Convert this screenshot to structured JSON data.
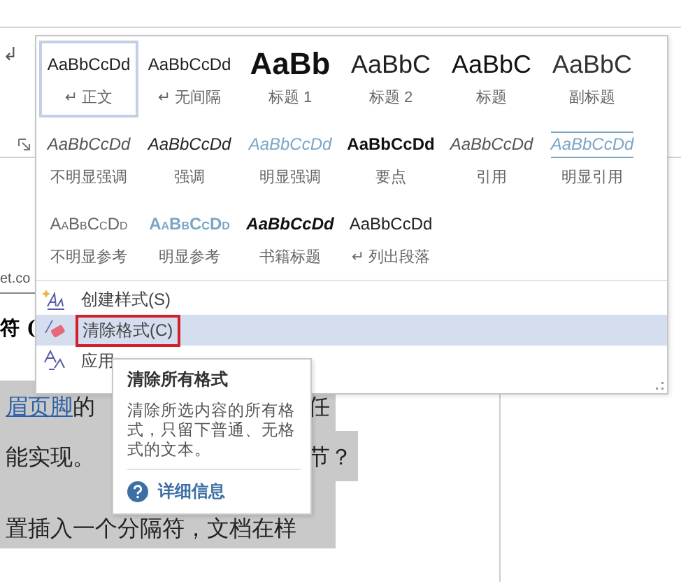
{
  "ribbon": {
    "paragraph_mark": "↲"
  },
  "document": {
    "url_fragment": "et.co",
    "heading_fragment": "符 (",
    "lines": [
      {
        "parts": [
          {
            "text": "眉页脚",
            "kind": "link"
          },
          {
            "text": "的",
            "kind": "text"
          },
          {
            "text": "任",
            "kind": "right"
          }
        ]
      },
      {
        "parts": [
          {
            "text": "能实现。",
            "kind": "text"
          },
          {
            "text": "节？",
            "kind": "right"
          }
        ]
      },
      {
        "parts": [
          {
            "text": "置插入一个分隔符，文档在样",
            "kind": "text"
          }
        ]
      }
    ]
  },
  "style_gallery": {
    "styles": [
      {
        "preview": "AaBbCcDd",
        "name": "↵ 正文",
        "kind": "normal",
        "selected": true
      },
      {
        "preview": "AaBbCcDd",
        "name": "↵ 无间隔",
        "kind": "normal",
        "selected": false
      },
      {
        "preview": "AaBb",
        "name": "标题 1",
        "kind": "heading1",
        "selected": false
      },
      {
        "preview": "AaBbC",
        "name": "标题 2",
        "kind": "heading2",
        "selected": false
      },
      {
        "preview": "AaBbC",
        "name": "标题",
        "kind": "title",
        "selected": false
      },
      {
        "preview": "AaBbC",
        "name": "副标题",
        "kind": "subtitle",
        "selected": false
      },
      {
        "preview": "AaBbCcDd",
        "name": "不明显强调",
        "kind": "subtle-emphasis",
        "selected": false
      },
      {
        "preview": "AaBbCcDd",
        "name": "强调",
        "kind": "emphasis",
        "selected": false
      },
      {
        "preview": "AaBbCcDd",
        "name": "明显强调",
        "kind": "intense-emphasis",
        "selected": false
      },
      {
        "preview": "AaBbCcDd",
        "name": "要点",
        "kind": "strong",
        "selected": false
      },
      {
        "preview": "AaBbCcDd",
        "name": "引用",
        "kind": "quote",
        "selected": false
      },
      {
        "preview": "AaBbCcDd",
        "name": "明显引用",
        "kind": "intense-quote",
        "selected": false
      },
      {
        "preview": "AaBbCcDd",
        "name": "不明显参考",
        "kind": "subtle-reference",
        "selected": false
      },
      {
        "preview": "AaBbCcDd",
        "name": "明显参考",
        "kind": "intense-reference",
        "selected": false
      },
      {
        "preview": "AaBbCcDd",
        "name": "书籍标题",
        "kind": "book-title",
        "selected": false
      },
      {
        "preview": "AaBbCcDd",
        "name": "↵ 列出段落",
        "kind": "normal",
        "selected": false
      }
    ],
    "menu": [
      {
        "label": "创建样式(S)",
        "kind": "create",
        "selected": false,
        "outlined": false
      },
      {
        "label": "清除格式(C)",
        "kind": "clear",
        "selected": true,
        "outlined": true
      },
      {
        "label": "应用",
        "kind": "apply",
        "selected": false,
        "outlined": false
      }
    ]
  },
  "tooltip": {
    "title": "清除所有格式",
    "description": "清除所选内容的所有格式，只留下普通、无格式的文本。",
    "help_link": "详细信息"
  }
}
